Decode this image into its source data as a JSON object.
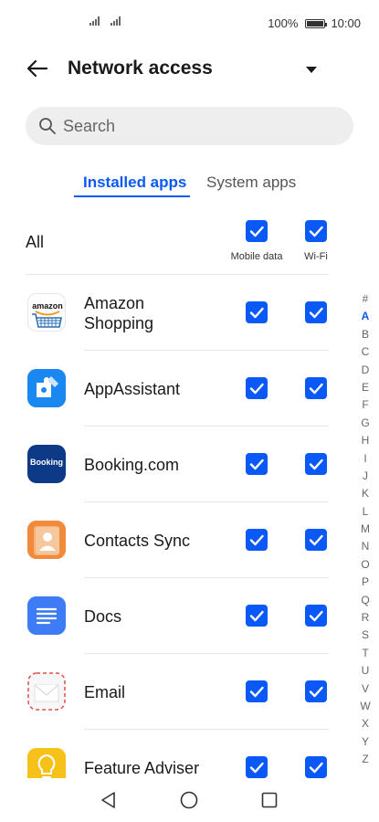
{
  "status_bar": {
    "battery_text": "100%",
    "time": "10:00"
  },
  "header": {
    "title": "Network access"
  },
  "search": {
    "placeholder": "Search"
  },
  "tabs": [
    {
      "label": "Installed apps",
      "active": true
    },
    {
      "label": "System apps",
      "active": false
    }
  ],
  "all_row": {
    "label": "All",
    "mobile_data_label": "Mobile data",
    "wifi_label": "Wi-Fi",
    "mobile_data_checked": true,
    "wifi_checked": true
  },
  "apps": [
    {
      "name": "Amazon Shopping",
      "name_line1": "Amazon",
      "name_line2": "Shopping",
      "icon": "amazon-icon",
      "mobile_data": true,
      "wifi": true
    },
    {
      "name": "AppAssistant",
      "icon": "app-assistant-icon",
      "mobile_data": true,
      "wifi": true
    },
    {
      "name": "Booking.com",
      "icon": "booking-icon",
      "icon_text": "Booking",
      "mobile_data": true,
      "wifi": true
    },
    {
      "name": "Contacts Sync",
      "icon": "contacts-sync-icon",
      "mobile_data": true,
      "wifi": true
    },
    {
      "name": "Docs",
      "icon": "docs-icon",
      "mobile_data": true,
      "wifi": true
    },
    {
      "name": "Email",
      "icon": "email-icon",
      "mobile_data": true,
      "wifi": true
    },
    {
      "name": "Feature Adviser",
      "icon": "feature-adviser-icon",
      "mobile_data": true,
      "wifi": true
    }
  ],
  "amazon_logo_text": "amazon",
  "alpha_index": [
    "#",
    "A",
    "B",
    "C",
    "D",
    "E",
    "F",
    "G",
    "H",
    "I",
    "J",
    "K",
    "L",
    "M",
    "N",
    "O",
    "P",
    "Q",
    "R",
    "S",
    "T",
    "U",
    "V",
    "W",
    "X",
    "Y",
    "Z"
  ],
  "alpha_active": "A",
  "colors": {
    "accent": "#0a59f7",
    "booking": "#0d3a87",
    "contacts": "#f08a3c",
    "docs": "#3d7cf4",
    "feature_adviser": "#f6c21a"
  }
}
